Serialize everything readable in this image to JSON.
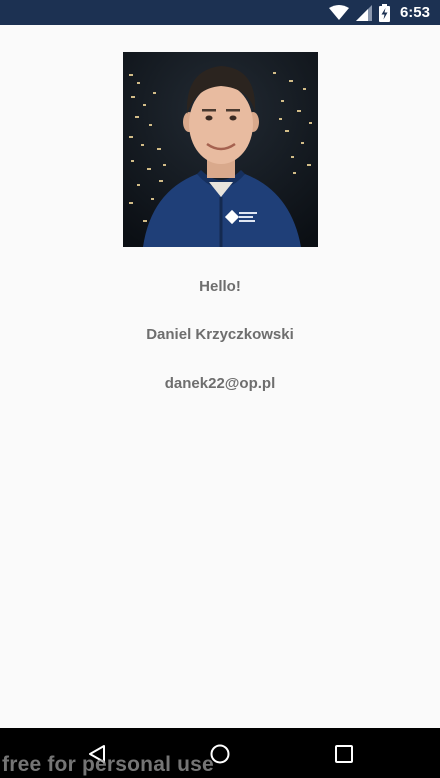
{
  "status_bar": {
    "time": "6:53",
    "icons": [
      "wifi-icon",
      "signal-icon",
      "battery-charging-icon"
    ],
    "background_color": "#1c3152"
  },
  "profile": {
    "photo_icon": "profile-photo",
    "greeting": "Hello!",
    "name": "Daniel Krzyczkowski",
    "email": "danek22@op.pl",
    "text_color": "#6e6e6e"
  },
  "nav_bar": {
    "buttons": [
      "back-icon",
      "home-icon",
      "recents-icon"
    ]
  },
  "watermark": "free for personal use"
}
